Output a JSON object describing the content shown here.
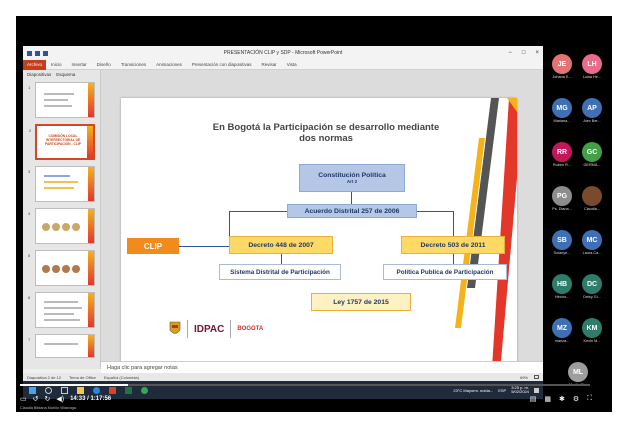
{
  "window": {
    "title": "PRESENTACIÓN CLIP y SDP - Microsoft PowerPoint",
    "controls": [
      "−",
      "□",
      "×"
    ]
  },
  "ribbon": {
    "file": "Archivo",
    "tabs": [
      "Inicio",
      "Insertar",
      "Diseño",
      "Transiciones",
      "Animaciones",
      "Presentación con diapositivas",
      "Revisar",
      "Vista"
    ]
  },
  "thumbs_panel": {
    "tabs": [
      "Diapositivas",
      "Esquema"
    ],
    "thumb_title": "COMISIÓN LOCAL INTERSECTORIAL DE PARTICIPACIÓN - CLIP",
    "numbers": [
      "1",
      "2",
      "3",
      "4",
      "5",
      "6",
      "7"
    ]
  },
  "slide": {
    "heading": "En Bogotá la Participación se desarrollo mediante dos normas",
    "constitucion": "Constitución Política",
    "art": "Art 2",
    "acuerdo": "Acuerdo Distrital  257 de 2006",
    "clip": "CLIP",
    "decreto448": "Decreto 448 de 2007",
    "decreto503": "Decreto 503 de 2011",
    "sistema": "Sistema Distrital de Participación",
    "politica": "Política Publica de Participación",
    "ley": "Ley 1757 de 2015",
    "logo_idpac": "IDPAC",
    "logo_bogota": "BOGOTA"
  },
  "notes_placeholder": "Haga clic para agregar notas",
  "status": {
    "slide": "Diapositiva 2 de 12",
    "theme": "Tema de Office",
    "lang": "Español (Colombia)",
    "zoom": "69%"
  },
  "taskbar": {
    "weather": "23°C  Mayorm. nubla...",
    "lang": "ESP",
    "time": "3:25 p. m.",
    "date": "5/02/2024"
  },
  "participants": [
    {
      "initials": "JE",
      "name": "Johana E...",
      "color": "#e57373"
    },
    {
      "initials": "LH",
      "name": "Luisa He...",
      "color": "#ec6b8a"
    },
    {
      "initials": "MG",
      "name": "Mariana...",
      "color": "#3f6fb5"
    },
    {
      "initials": "AP",
      "name": "Alex Ber...",
      "color": "#3f6fb5"
    },
    {
      "initials": "RR",
      "name": "Ruben R...",
      "color": "#c2185b"
    },
    {
      "initials": "GC",
      "name": "GERMÁ...",
      "color": "#43a047"
    },
    {
      "initials": "PG",
      "name": "Ps. Diana...",
      "color": "#8d8d8d"
    },
    {
      "initials": "",
      "name": "Claudia...",
      "color": "#7a4a2c"
    },
    {
      "initials": "SB",
      "name": "Solanye...",
      "color": "#3f6fb5"
    },
    {
      "initials": "MC",
      "name": "Laura Ca...",
      "color": "#3f6fb5"
    },
    {
      "initials": "HB",
      "name": "Héctor...",
      "color": "#2e7d6b"
    },
    {
      "initials": "DC",
      "name": "Deisy Gi...",
      "color": "#2e7d6b"
    },
    {
      "initials": "MZ",
      "name": "mariza...",
      "color": "#3f6fb5"
    },
    {
      "initials": "KM",
      "name": "Kevin M...",
      "color": "#2e7d6b"
    },
    {
      "initials": "ML",
      "name": "Marilin R...",
      "color": "#9e9e9e"
    }
  ],
  "playback": {
    "time": "14:33 / 1:17:56",
    "progress": 0.19,
    "caption": "Claudia Bibiana Murillo Villarraga"
  },
  "colors": {
    "accent_orange": "#f28b1e",
    "accent_red": "#e3372a",
    "box_blue": "#b4c7e7",
    "box_yellow": "#ffd966"
  }
}
